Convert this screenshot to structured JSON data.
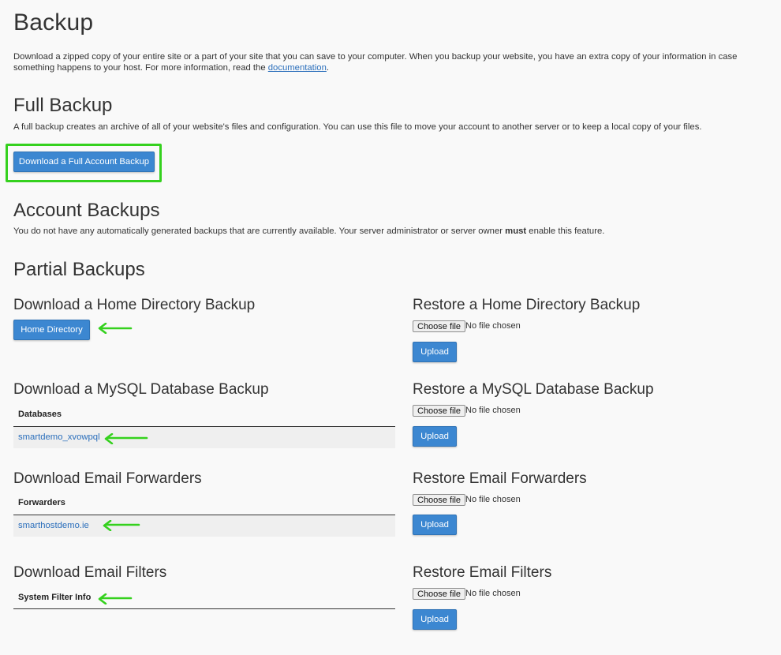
{
  "page": {
    "title": "Backup",
    "intro_text": "Download a zipped copy of your entire site or a part of your site that you can save to your computer. When you backup your website, you have an extra copy of your information in case something happens to your host. For more information, read the ",
    "intro_link": "documentation",
    "intro_end": "."
  },
  "full_backup": {
    "heading": "Full Backup",
    "description": "A full backup creates an archive of all of your website's files and configuration. You can use this file to move your account to another server or to keep a local copy of your files.",
    "button_label": "Download a Full Account Backup"
  },
  "account_backups": {
    "heading": "Account Backups",
    "text_before": "You do not have any automatically generated backups that are currently available. Your server administrator or server owner ",
    "text_bold": "must",
    "text_after": " enable this feature."
  },
  "partial_backups": {
    "heading": "Partial Backups",
    "home": {
      "download_heading": "Download a Home Directory Backup",
      "button_label": "Home Directory",
      "restore_heading": "Restore a Home Directory Backup"
    },
    "mysql": {
      "download_heading": "Download a MySQL Database Backup",
      "column_header": "Databases",
      "items": [
        "smartdemo_xvowpql"
      ],
      "restore_heading": "Restore a MySQL Database Backup"
    },
    "forwarders": {
      "download_heading": "Download Email Forwarders",
      "column_header": "Forwarders",
      "items": [
        "smarthostdemo.ie"
      ],
      "restore_heading": "Restore Email Forwarders"
    },
    "filters": {
      "download_heading": "Download Email Filters",
      "column_header": "System Filter Info",
      "restore_heading": "Restore Email Filters"
    },
    "file_input": {
      "choose_label": "Choose file",
      "status": "No file chosen"
    },
    "upload_label": "Upload"
  },
  "colors": {
    "button_blue": "#3c87d1",
    "link_blue": "#2a6ebb",
    "annotation_green": "#35d11e"
  }
}
